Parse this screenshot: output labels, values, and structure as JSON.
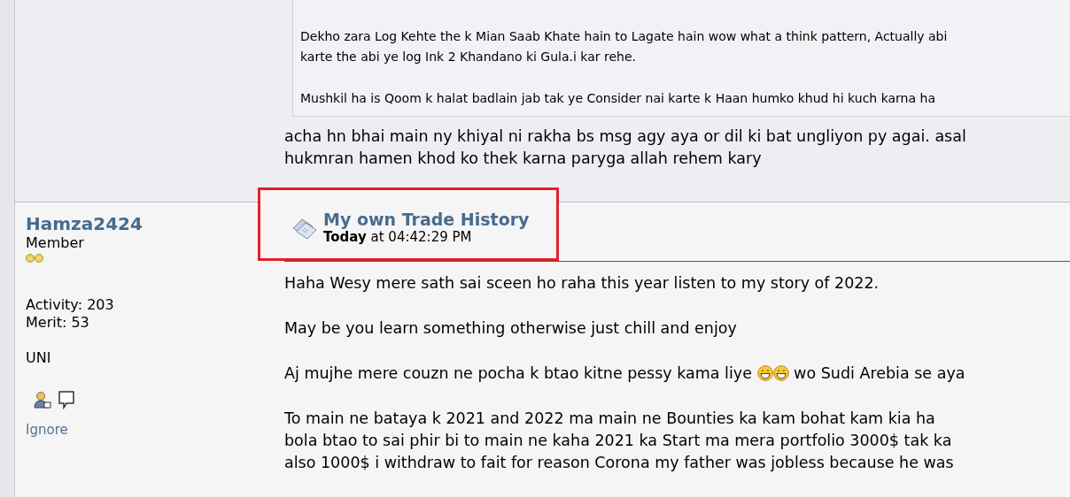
{
  "previous_post": {
    "quote": {
      "paragraphs": [
        [
          "Dekho zara Log Kehte the k Mian Saab Khate hain to Lagate hain wow what a think pattern, Actually abi",
          "karte the abi ye log Ink 2 Khandano ki Gula.i kar rehe."
        ],
        [
          "Mushkil ha is Qoom k halat badlain jab tak ye Consider nai karte k Haan humko khud hi kuch karna ha"
        ]
      ]
    },
    "body": [
      "acha hn bhai main ny khiyal ni rakha bs msg agy aya or dil ki bat ungliyon py agai. asal",
      "hukmran hamen khod ko thek karna paryga allah rehem kary"
    ]
  },
  "post": {
    "author": {
      "name": "Hamza2424",
      "rank": "Member",
      "rank_icons": [
        {
          "kind": "coin"
        },
        {
          "kind": "coin"
        }
      ],
      "activity": "Activity: 203",
      "merit": "Merit: 53",
      "personal_text": "UNI",
      "ignore": "Ignore"
    },
    "title": "My own Trade History",
    "date_bold": "Today",
    "date_rest": "at 04:42:29 PM",
    "highlighted": true,
    "paragraphs": [
      [
        [
          {
            "kind": "text",
            "text": "Haha Wesy mere sath sai sceen ho raha this year listen to my story of 2022."
          }
        ]
      ],
      [
        [
          {
            "kind": "text",
            "text": "May be you learn something otherwise just chill and enjoy"
          }
        ]
      ],
      [
        [
          {
            "kind": "text",
            "text": "Aj mujhe mere couzn ne pocha k btao kitne pessy kama liye "
          },
          {
            "kind": "emoji"
          },
          {
            "kind": "emoji"
          },
          {
            "kind": "text",
            "text": " wo Sudi Arebia se aya"
          }
        ]
      ],
      [
        [
          {
            "kind": "text",
            "text": "To main ne bataya k 2021 and 2022 ma main ne Bounties ka kam bohat kam kia ha"
          }
        ],
        [
          {
            "kind": "text",
            "text": "bola btao to sai phir bi to main ne kaha 2021 ka Start ma mera portfolio 3000$ tak ka"
          }
        ],
        [
          {
            "kind": "text",
            "text": "also 1000$ i withdraw to fait for reason Corona my father was jobless because he was"
          }
        ]
      ]
    ]
  }
}
